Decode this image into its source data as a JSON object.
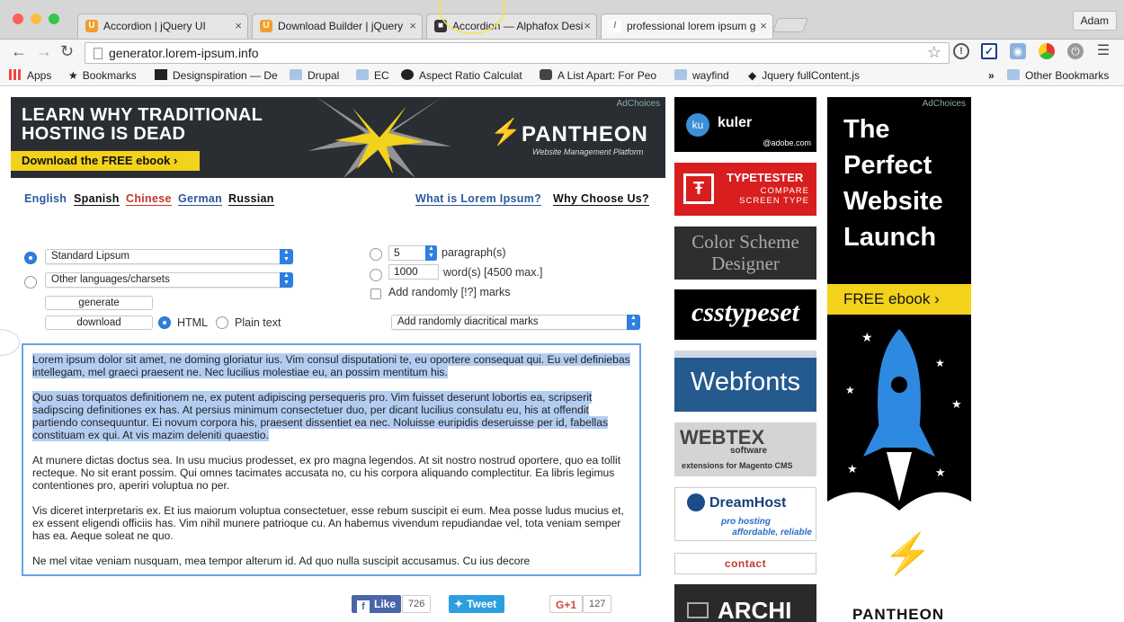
{
  "tabs": [
    {
      "label": "Accordion | jQuery UI",
      "fav": "U",
      "color": "#f29d2c"
    },
    {
      "label": "Download Builder | jQuery",
      "fav": "U",
      "color": "#f29d2c"
    },
    {
      "label": "Accordion — Alphafox Desi",
      "fav": "■",
      "color": "#333333"
    },
    {
      "label": "professional lorem ipsum g",
      "fav": "/",
      "color": "#888888"
    }
  ],
  "profile": "Adam",
  "url": "generator.lorem-ipsum.info",
  "bookmarks": {
    "apps": "Apps",
    "bookmarks": "Bookmarks",
    "designspiration": "Designspiration — De",
    "drupal": "Drupal",
    "ec": "EC",
    "aspect": "Aspect Ratio Calculat",
    "alistapart": "A List Apart: For Peo",
    "wayfind": "wayfind",
    "jquery": "Jquery fullContent.js",
    "more": "»",
    "other": "Other Bookmarks"
  },
  "banner": {
    "headline1": "LEARN WHY TRADITIONAL",
    "headline2": "HOSTING IS DEAD",
    "cta": "Download the FREE ebook ›",
    "logo": "PANTHEON",
    "sub": "Website Management Platform",
    "adchoices": "AdChoices"
  },
  "languages": {
    "english": "English",
    "spanish": "Spanish",
    "chinese": "Chinese",
    "german": "German",
    "russian": "Russian"
  },
  "links": {
    "what": "What is Lorem Ipsum?",
    "why": "Why Choose Us?"
  },
  "form": {
    "standard": "Standard Lipsum",
    "other": "Other languages/charsets",
    "generate": "generate",
    "download": "download",
    "html": "HTML",
    "plain": "Plain text",
    "paragraphs_value": "5",
    "paragraphs_label": "paragraph(s)",
    "words_value": "1000",
    "words_label": "word(s) [4500 max.]",
    "random_marks": "Add randomly [!?] marks",
    "diacritical": "Add randomly diacritical marks"
  },
  "lorem": {
    "p1": "Lorem ipsum dolor sit amet, ne doming gloriatur ius. Vim consul disputationi te, eu oportere consequat qui. Eu vel definiebas intellegam, mel graeci praesent ne. Nec lucilius molestiae eu, an possim mentitum his.",
    "p2": "Quo suas torquatos definitionem ne, ex putent adipiscing persequeris pro. Vim fuisset deserunt lobortis ea, scripserit sadipscing definitiones ex has. At persius minimum consectetuer duo, per dicant lucilius consulatu eu, his at offendit partiendo consequuntur. Ei novum corpora his, praesent dissentiet ea nec. Noluisse euripidis deseruisse per id, fabellas constituam ex qui. At vis mazim deleniti quaestio.",
    "p3": "At munere dictas doctus sea. In usu mucius prodesset, ex pro magna legendos. At sit nostro nostrud oportere, quo ea tollit recteque. No sit erant possim. Qui omnes tacimates accusata no, cu his corpora aliquando complectitur. Ea libris legimus contentiones pro, aperiri voluptua no per.",
    "p4": "Vis diceret interpretaris ex. Et ius maiorum voluptua consectetuer, esse rebum suscipit ei eum. Mea posse ludus mucius et, ex essent eligendi officiis has. Vim nihil munere patrioque cu. An habemus vivendum repudiandae vel, tota veniam semper has ea. Aeque soleat ne quo.",
    "p5": "Ne mel vitae veniam nusquam, mea tempor alterum id. Ad quo nulla suscipit accusamus. Cu ius decore"
  },
  "social": {
    "like": "Like",
    "like_count": "726",
    "tweet": "Tweet",
    "gplus": "G+1",
    "gplus_count": "127"
  },
  "sidebar_ads": {
    "kuler": "kuler",
    "kuler_sub": "@adobe.com",
    "kuler_badge": "ku",
    "typetester": "TYPETESTER",
    "typetester_sub1": "COMPARE",
    "typetester_sub2": "SCREEN TYPE",
    "colorscheme1": "Color Scheme",
    "colorscheme2": "Designer",
    "csstypeset": "csstypeset",
    "webfonts": "Webfonts",
    "webtex": "WEBTEX",
    "webtex_sub": "software",
    "webtex_sub2": "extensions for Magento CMS",
    "dreamhost": "DreamHost",
    "dreamhost_sub1": "pro hosting",
    "dreamhost_sub2": "affordable, reliable",
    "contact": "contact",
    "archi": "ARCHI"
  },
  "tall_ad": {
    "line1": "The",
    "line2": "Perfect",
    "line3": "Website",
    "line4": "Launch",
    "cta": "FREE ebook ›",
    "logo": "PANTHEON",
    "adchoices": "AdChoices"
  },
  "colors": {
    "accent_blue": "#2d7fe0",
    "link_blue": "#2a5a9c",
    "chinese_red": "#c0392b",
    "pantheon_yellow": "#f2d21a"
  }
}
